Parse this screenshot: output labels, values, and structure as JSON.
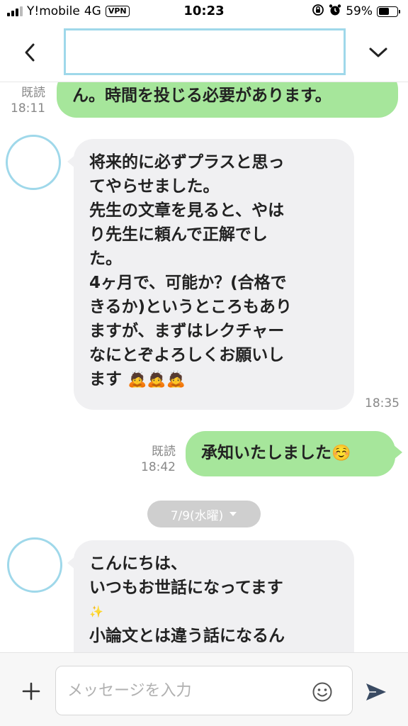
{
  "status_bar": {
    "carrier": "Y!mobile",
    "network": "4G",
    "vpn": "VPN",
    "time": "10:23",
    "battery_percent": "59%",
    "battery_level": 0.59
  },
  "header": {
    "back_icon": "chevron-left-icon",
    "menu_icon": "chevron-down-icon"
  },
  "messages": [
    {
      "direction": "outgoing",
      "lines": [
        "ん。時間を投じる必要があります。"
      ],
      "read": "既読",
      "time": "18:11"
    },
    {
      "direction": "incoming",
      "lines": [
        "将来的に必ずプラスと思っ",
        "てやらせました。",
        "先生の文章を見ると、やは",
        "り先生に頼んで正解でし",
        "た。",
        "4ヶ月で、可能か？(合格で",
        "きるか)というところもあり",
        "ますが、まずはレクチャー",
        "なにとぞよろしくお願いし",
        "ます"
      ],
      "emojis": "🙇🙇🙇",
      "time": "18:35"
    },
    {
      "direction": "outgoing",
      "text": "承知いたしました",
      "emoji": "☺️",
      "read": "既読",
      "time": "18:42"
    },
    {
      "direction": "incoming",
      "lines": [
        "こんにちは、",
        "いつもお世話になってます",
        "✨",
        "小論文とは違う話になるん"
      ]
    }
  ],
  "date_separator": {
    "label": "7/9(水曜)"
  },
  "input_bar": {
    "placeholder": "メッセージを入力",
    "plus_icon": "plus-icon",
    "emoji_icon": "smile-icon",
    "send_icon": "send-icon"
  },
  "colors": {
    "outgoing_bubble": "#a6e69b",
    "incoming_bubble": "#f0f0f2",
    "avatar_border": "#9fd8ea",
    "date_pill": "#cfcfcf"
  }
}
